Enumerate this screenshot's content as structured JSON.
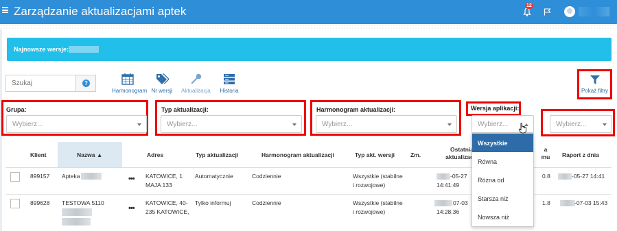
{
  "header": {
    "title": "Zarządzanie aktualizacjami aptek",
    "notification_count": "12"
  },
  "banner": {
    "label": "Najnowsze wersje:"
  },
  "toolbar": {
    "search_placeholder": "Szukaj",
    "items": [
      {
        "label": "Harmonogram",
        "icon": "calendar-icon"
      },
      {
        "label": "Nr wersji",
        "icon": "tags-icon"
      },
      {
        "label": "Aktualizacja",
        "icon": "wrench-icon"
      },
      {
        "label": "Historia",
        "icon": "list-icon"
      }
    ],
    "filter_label": "Pokaż filtry"
  },
  "filters": {
    "grupa": {
      "label": "Grupa:",
      "placeholder": "Wybierz..."
    },
    "typ": {
      "label": "Typ aktualizacji:",
      "placeholder": "Wybierz..."
    },
    "harmonogram": {
      "label": "Harmonogram aktualizacji:",
      "placeholder": "Wybierz..."
    },
    "wersja": {
      "label": "Wersja aplikacji:",
      "placeholder": "Wybierz..."
    },
    "extra": {
      "placeholder": "Wybierz..."
    }
  },
  "dropdown": {
    "options": [
      "Wszystkie",
      "Równa",
      "Różna od",
      "Starsza niż",
      "Nowsza niż"
    ],
    "selected": "Wszystkie"
  },
  "table": {
    "headers": {
      "klient": "Klient",
      "nazwa": "Nazwa ▲",
      "adres": "Adres",
      "typ_aktualizacji": "Typ aktualizacji",
      "harmonogram": "Harmonogram aktualizacji",
      "typ_akt_wersji": "Typ akt. wersji",
      "zm": "Zm.",
      "ostatnia_1": "Ostatnia",
      "ostatnia_2": "aktualizacja",
      "wersja_1": "a",
      "wersja_2": "mu",
      "raport": "Raport z dnia"
    },
    "rows": [
      {
        "klient": "899157",
        "nazwa": "Apteka",
        "adres_1": "KATOWICE, 1",
        "adres_2": "MAJA 133",
        "typ": "Automatycznie",
        "harmonogram": "Codziennie",
        "typ_wersji_1": "Wszystkie (stabilne",
        "typ_wersji_2": "i rozwojowe)",
        "ostatnia_1": "-05-27",
        "ostatnia_2": "14:41:49",
        "wersja": "0.8",
        "raport": "-05-27 14:41"
      },
      {
        "klient": "899628",
        "nazwa": "TESTOWA 5110",
        "adres_1": "KATOWICE, 40-",
        "adres_2": "235 KATOWICE,",
        "typ": "Tylko informuj",
        "harmonogram": "Codziennie",
        "typ_wersji_1": "Wszystkie (stabilne",
        "typ_wersji_2": "i rozwojowe)",
        "ostatnia_1": "07-03",
        "ostatnia_2": "14:28:36",
        "wersja": "1.8",
        "raport": "-07-03 15:43"
      }
    ]
  },
  "colors": {
    "topbar": "#2f8ed8",
    "banner": "#21bfe9",
    "highlight_border": "#e00000",
    "dropdown_active": "#2d6ca8"
  }
}
